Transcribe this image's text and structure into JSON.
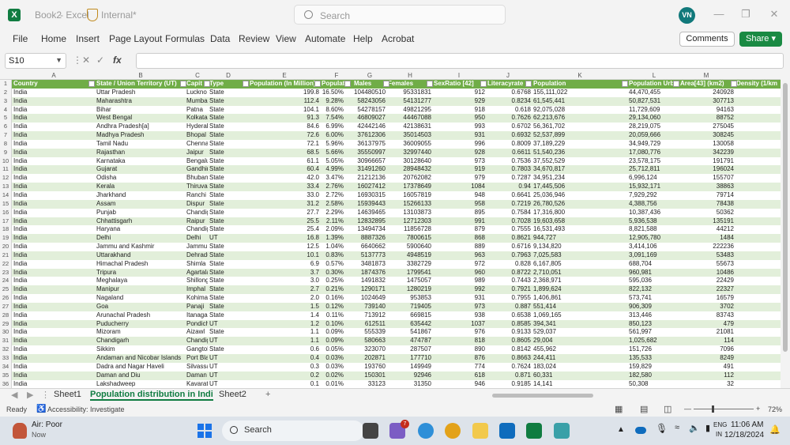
{
  "window": {
    "book": "Book2",
    "sep": "-",
    "app": "Excel",
    "label": "Internal*",
    "search_placeholder": "Search",
    "avatar": "VN"
  },
  "ribbon": {
    "tabs": [
      "File",
      "Home",
      "Insert",
      "Page Layout",
      "Formulas",
      "Data",
      "Review",
      "View",
      "Automate",
      "Help",
      "Acrobat"
    ],
    "comments": "Comments",
    "share": "Share"
  },
  "formula": {
    "namebox": "S10",
    "fx": "fx"
  },
  "grid": {
    "col_letters": [
      "A",
      "B",
      "C",
      "D",
      "E",
      "F",
      "G",
      "H",
      "I",
      "J",
      "K",
      "L",
      "M"
    ],
    "headers": [
      "Country",
      "State /  Union Territory (UT)",
      "Capit",
      "Type",
      "Population (In Million)",
      "Populati",
      "Males",
      "Females",
      "SexRatio [42]",
      "Literacyrate",
      "Population Rural",
      "Population Urba",
      "Area[43]  (km2)",
      "Density  (1/km"
    ],
    "rows": [
      [
        "India",
        "Uttar Pradesh",
        "Luckno",
        "State",
        "199.8",
        "16.50%",
        "104480510",
        "95331831",
        "912",
        "0.6768",
        "155,111,022",
        "44,470,455",
        "240928",
        ""
      ],
      [
        "India",
        "Maharashtra",
        "Mumbai",
        "State",
        "112.4",
        "9.28%",
        "58243056",
        "54131277",
        "929",
        "0.8234",
        "61,545,441",
        "50,827,531",
        "307713",
        ""
      ],
      [
        "India",
        "Bihar",
        "Patna",
        "State",
        "104.1",
        "8.60%",
        "54278157",
        "49821295",
        "918",
        "0.618",
        "92,075,028",
        "11,729,609",
        "94163",
        ""
      ],
      [
        "India",
        "West Bengal",
        "Kolkata",
        "State",
        "91.3",
        "7.54%",
        "46809027",
        "44467088",
        "950",
        "0.7626",
        "62,213,676",
        "29,134,060",
        "88752",
        ""
      ],
      [
        "India",
        "Andhra Pradesh[a]",
        "Hyderab",
        "State",
        "84.6",
        "6.99%",
        "42442146",
        "42138631",
        "993",
        "0.6702",
        "56,361,702",
        "28,219,075",
        "275045",
        ""
      ],
      [
        "India",
        "Madhya Pradesh",
        "Bhopal",
        "State",
        "72.6",
        "6.00%",
        "37612306",
        "35014503",
        "931",
        "0.6932",
        "52,537,899",
        "20,059,666",
        "308245",
        ""
      ],
      [
        "India",
        "Tamil Nadu",
        "Chennai",
        "State",
        "72.1",
        "5.96%",
        "36137975",
        "36009055",
        "996",
        "0.8009",
        "37,189,229",
        "34,949,729",
        "130058",
        ""
      ],
      [
        "India",
        "Rajasthan",
        "Jaipur",
        "State",
        "68.5",
        "5.66%",
        "35550997",
        "32997440",
        "928",
        "0.6611",
        "51,540,236",
        "17,080,776",
        "342239",
        ""
      ],
      [
        "India",
        "Karnataka",
        "Bengalu",
        "State",
        "61.1",
        "5.05%",
        "30966657",
        "30128640",
        "973",
        "0.7536",
        "37,552,529",
        "23,578,175",
        "191791",
        ""
      ],
      [
        "India",
        "Gujarat",
        "Gandhin",
        "State",
        "60.4",
        "4.99%",
        "31491260",
        "28948432",
        "919",
        "0.7803",
        "34,670,817",
        "25,712,811",
        "196024",
        ""
      ],
      [
        "India",
        "Odisha",
        "Bhuban",
        "State",
        "42.0",
        "3.47%",
        "21212136",
        "20762082",
        "979",
        "0.7287",
        "34,951,234",
        "6,996,124",
        "155707",
        ""
      ],
      [
        "India",
        "Kerala",
        "Thiruvar",
        "State",
        "33.4",
        "2.76%",
        "16027412",
        "17378649",
        "1084",
        "0.94",
        "17,445,506",
        "15,932,171",
        "38863",
        ""
      ],
      [
        "India",
        "Jharkhand",
        "Ranchi",
        "State",
        "33.0",
        "2.72%",
        "16930315",
        "16057819",
        "948",
        "0.6641",
        "25,036,946",
        "7,929,292",
        "79714",
        ""
      ],
      [
        "India",
        "Assam",
        "Dispur",
        "State",
        "31.2",
        "2.58%",
        "15939443",
        "15266133",
        "958",
        "0.7219",
        "26,780,526",
        "4,388,756",
        "78438",
        ""
      ],
      [
        "India",
        "Punjab",
        "Chandig",
        "State",
        "27.7",
        "2.29%",
        "14639465",
        "13103873",
        "895",
        "0.7584",
        "17,316,800",
        "10,387,436",
        "50362",
        ""
      ],
      [
        "India",
        "Chhattisgarh",
        "Raipur",
        "State",
        "25.5",
        "2.11%",
        "12832895",
        "12712303",
        "991",
        "0.7028",
        "19,603,658",
        "5,936,538",
        "135191",
        ""
      ],
      [
        "India",
        "Haryana",
        "Chandig",
        "State",
        "25.4",
        "2.09%",
        "13494734",
        "11856728",
        "879",
        "0.7555",
        "16,531,493",
        "8,821,588",
        "44212",
        ""
      ],
      [
        "India",
        "Delhi",
        "Delhi",
        "UT",
        "16.8",
        "1.39%",
        "8887326",
        "7800615",
        "868",
        "0.8621",
        "944,727",
        "12,905,780",
        "1484",
        ""
      ],
      [
        "India",
        "Jammu and Kashmir",
        "Jammu",
        "State",
        "12.5",
        "1.04%",
        "6640662",
        "5900640",
        "889",
        "0.6716",
        "9,134,820",
        "3,414,106",
        "222236",
        ""
      ],
      [
        "India",
        "Uttarakhand",
        "Dehradu",
        "State",
        "10.1",
        "0.83%",
        "5137773",
        "4948519",
        "963",
        "0.7963",
        "7,025,583",
        "3,091,169",
        "53483",
        ""
      ],
      [
        "India",
        "Himachal Pradesh",
        "Shimla",
        "State",
        "6.9",
        "0.57%",
        "3481873",
        "3382729",
        "972",
        "0.828",
        "6,167,805",
        "688,704",
        "55673",
        ""
      ],
      [
        "India",
        "Tripura",
        "Agartala",
        "State",
        "3.7",
        "0.30%",
        "1874376",
        "1799541",
        "960",
        "0.8722",
        "2,710,051",
        "960,981",
        "10486",
        ""
      ],
      [
        "India",
        "Meghalaya",
        "Shillong",
        "State",
        "3.0",
        "0.25%",
        "1491832",
        "1475057",
        "989",
        "0.7443",
        "2,368,971",
        "595,036",
        "22429",
        ""
      ],
      [
        "India",
        "Manipur",
        "Imphal",
        "State",
        "2.7",
        "0.21%",
        "1290171",
        "1280219",
        "992",
        "0.7921",
        "1,899,624",
        "822,132",
        "22327",
        ""
      ],
      [
        "India",
        "Nagaland",
        "Kohima",
        "State",
        "2.0",
        "0.16%",
        "1024649",
        "953853",
        "931",
        "0.7955",
        "1,406,861",
        "573,741",
        "16579",
        ""
      ],
      [
        "India",
        "Goa",
        "Panaji",
        "State",
        "1.5",
        "0.12%",
        "739140",
        "719405",
        "973",
        "0.887",
        "551,414",
        "906,309",
        "3702",
        ""
      ],
      [
        "India",
        "Arunachal Pradesh",
        "Itanagar",
        "State",
        "1.4",
        "0.11%",
        "713912",
        "669815",
        "938",
        "0.6538",
        "1,069,165",
        "313,446",
        "83743",
        ""
      ],
      [
        "India",
        "Puducherry",
        "Pondich",
        "UT",
        "1.2",
        "0.10%",
        "612511",
        "635442",
        "1037",
        "0.8585",
        "394,341",
        "850,123",
        "479",
        ""
      ],
      [
        "India",
        "Mizoram",
        "Aizawl",
        "State",
        "1.1",
        "0.09%",
        "555339",
        "541867",
        "976",
        "0.9133",
        "529,037",
        "561,997",
        "21081",
        ""
      ],
      [
        "India",
        "Chandigarh",
        "Chandig",
        "UT",
        "1.1",
        "0.09%",
        "580663",
        "474787",
        "818",
        "0.8605",
        "29,004",
        "1,025,682",
        "114",
        ""
      ],
      [
        "India",
        "Sikkim",
        "Gangtok",
        "State",
        "0.6",
        "0.05%",
        "323070",
        "287507",
        "890",
        "0.8142",
        "455,962",
        "151,726",
        "7096",
        ""
      ],
      [
        "India",
        "Andaman and Nicobar Islands",
        "Port Bla",
        "UT",
        "0.4",
        "0.03%",
        "202871",
        "177710",
        "876",
        "0.8663",
        "244,411",
        "135,533",
        "8249",
        ""
      ],
      [
        "India",
        "Dadra and Nagar Haveli",
        "Silvassa",
        "UT",
        "0.3",
        "0.03%",
        "193760",
        "149949",
        "774",
        "0.7624",
        "183,024",
        "159,829",
        "491",
        ""
      ],
      [
        "India",
        "Daman and Diu",
        "Daman",
        "UT",
        "0.2",
        "0.02%",
        "150301",
        "92946",
        "618",
        "0.871",
        "60,331",
        "182,580",
        "112",
        ""
      ],
      [
        "India",
        "Lakshadweep",
        "Kavaratt",
        "UT",
        "0.1",
        "0.01%",
        "33123",
        "31350",
        "946",
        "0.9185",
        "14,141",
        "50,308",
        "32",
        ""
      ]
    ]
  },
  "sheets": {
    "tabs": [
      "Sheet1",
      "Population distribution in Indi",
      "Sheet2"
    ],
    "add": "+"
  },
  "status": {
    "ready": "Ready",
    "accessibility": "Accessibility: Investigate",
    "zoom": "72%",
    "minus": "—",
    "plus": "+"
  },
  "taskbar": {
    "weather_title": "Air: Poor",
    "weather_sub": "Now",
    "search": "Search",
    "badge": "7",
    "lang": "ENG",
    "region": "IN",
    "time": "11:06 AM",
    "date": "12/18/2024"
  }
}
